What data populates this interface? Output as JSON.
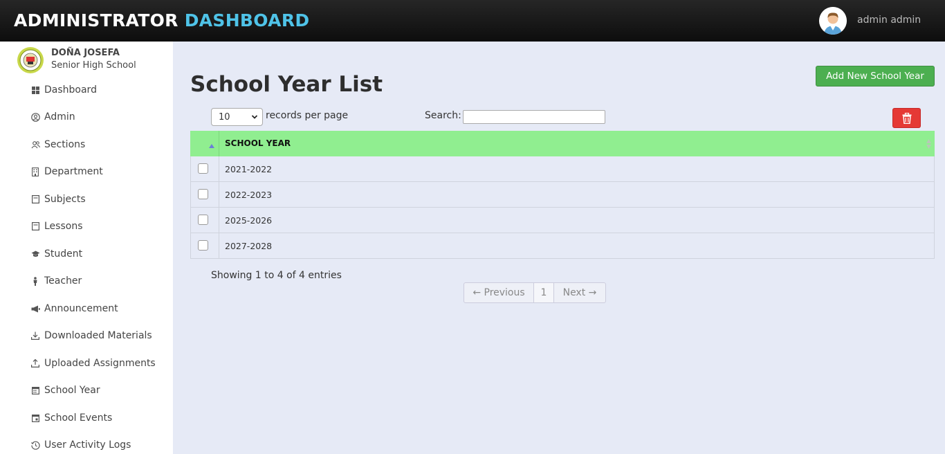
{
  "header": {
    "brand_main": "ADMINISTRATOR",
    "brand_accent": "DASHBOARD",
    "user_name": "admin admin"
  },
  "sidebar": {
    "school_name_line1": "DOÑA JOSEFA",
    "school_name_line2": "Senior High School",
    "items": [
      {
        "label": "Dashboard",
        "icon": "grid-icon"
      },
      {
        "label": "Admin",
        "icon": "user-circle-icon"
      },
      {
        "label": "Sections",
        "icon": "users-icon"
      },
      {
        "label": "Department",
        "icon": "building-icon"
      },
      {
        "label": "Subjects",
        "icon": "book-icon"
      },
      {
        "label": "Lessons",
        "icon": "book-icon"
      },
      {
        "label": "Student",
        "icon": "graduation-cap-icon"
      },
      {
        "label": "Teacher",
        "icon": "person-icon"
      },
      {
        "label": "Announcement",
        "icon": "megaphone-icon"
      },
      {
        "label": "Downloaded Materials",
        "icon": "download-icon"
      },
      {
        "label": "Uploaded Assignments",
        "icon": "upload-icon"
      },
      {
        "label": "School Year",
        "icon": "calendar-icon"
      },
      {
        "label": "School Events",
        "icon": "calendar-icon"
      },
      {
        "label": "User Activity Logs",
        "icon": "history-icon"
      }
    ]
  },
  "main": {
    "title": "School Year List",
    "add_button": "Add New School Year",
    "length_value": "10",
    "length_label": "records per page",
    "search_label": "Search:",
    "search_value": "",
    "table": {
      "column_header": "SCHOOL YEAR",
      "rows": [
        "2021-2022",
        "2022-2023",
        "2025-2026",
        "2027-2028"
      ]
    },
    "info": "Showing 1 to 4 of 4 entries",
    "pagination": {
      "previous": "← Previous",
      "current_page": "1",
      "next": "Next →"
    }
  },
  "colors": {
    "accent": "#4fc3e8",
    "table_header": "#90ee90",
    "add_button": "#4caf50",
    "delete_button": "#e53935",
    "content_background": "#e6eaf6"
  }
}
